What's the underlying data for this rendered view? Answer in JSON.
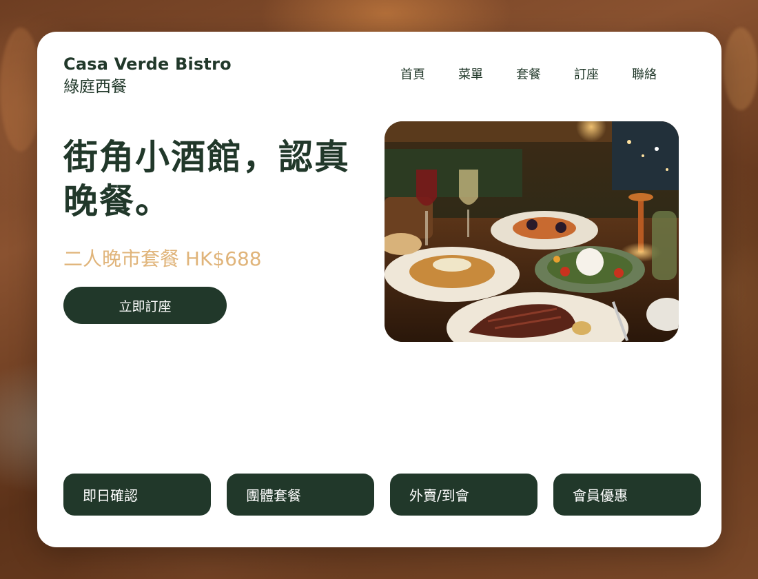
{
  "brand": {
    "name_en": "Casa Verde Bistro",
    "name_zh": "綠庭西餐"
  },
  "nav": {
    "items": [
      {
        "label": "首頁"
      },
      {
        "label": "菜單"
      },
      {
        "label": "套餐"
      },
      {
        "label": "訂座"
      },
      {
        "label": "聯絡"
      }
    ]
  },
  "hero": {
    "headline": "街角小酒館，認真晚餐。",
    "offer": "二人晚市套餐 HK$688",
    "cta_label": "立即訂座",
    "image_icon": "restaurant-dinner-photo"
  },
  "features": {
    "items": [
      {
        "label": "即日確認"
      },
      {
        "label": "團體套餐"
      },
      {
        "label": "外賣/到會"
      },
      {
        "label": "會員優惠"
      }
    ]
  },
  "colors": {
    "primary": "#21382a",
    "accent": "#e0b47a",
    "card": "#ffffff"
  }
}
